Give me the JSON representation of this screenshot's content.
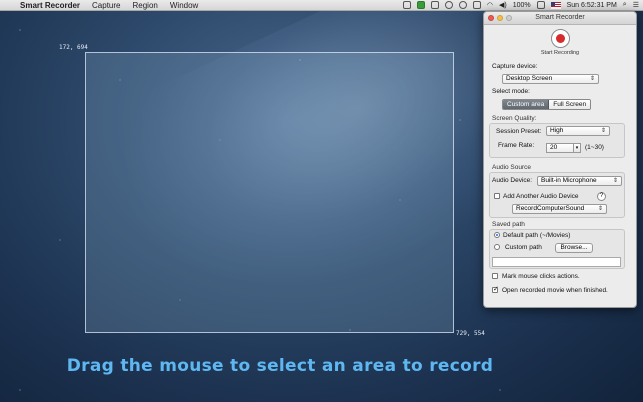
{
  "menubar": {
    "app_name": "Smart Recorder",
    "menus": [
      "Capture",
      "Region",
      "Window"
    ],
    "battery": "100%",
    "clock": "Sun 6:52:31 PM"
  },
  "selection": {
    "top_left_coord": "172, 694",
    "bottom_right_coord": "729, 554"
  },
  "caption": "Drag the mouse to select an area to record",
  "panel": {
    "title": "Smart Recorder",
    "record_label": "Start Recording",
    "capture_device_label": "Capture device:",
    "capture_device_value": "Desktop Screen",
    "select_mode_label": "Select mode:",
    "mode_options": [
      "Custom area",
      "Full Screen"
    ],
    "mode_selected": "Custom area",
    "screen_quality": {
      "title": "Screen  Quality:",
      "preset_label": "Session Preset:",
      "preset_value": "High",
      "frame_rate_label": "Frame Rate:",
      "frame_rate_value": "20",
      "frame_rate_range": "(1~30)"
    },
    "audio_source": {
      "title": "Audio Source",
      "device_label": "Audio Device:",
      "device_value": "Built-in Microphone",
      "add_another_label": "Add Another Audio Device",
      "add_another_checked": false,
      "help_glyph": "?",
      "second_device_value": "RecordComputerSound"
    },
    "saved_path": {
      "title": "Saved path",
      "default_label": "Default path (~/Movies)",
      "custom_label": "Custom path",
      "browse_label": "Browse...",
      "selected": "default",
      "path_value": ""
    },
    "mark_clicks_label": "Mark mouse clicks actions.",
    "mark_clicks_checked": false,
    "open_when_finished_label": "Open recorded movie when finished.",
    "open_when_finished_checked": true
  }
}
